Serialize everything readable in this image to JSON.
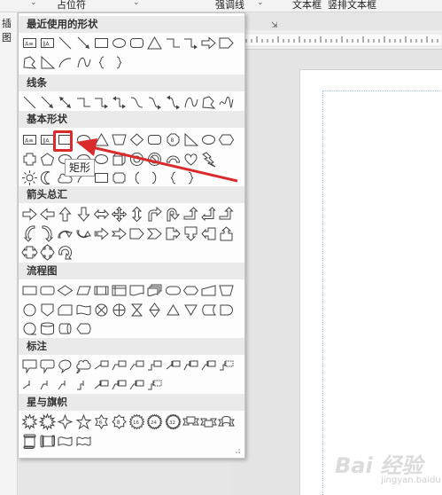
{
  "ribbon": {
    "placeholder_label": "占位符",
    "emphasis_label": "强调线",
    "textbox_label": "文本框",
    "vertical_textbox_label": "竖排文本框",
    "insert_label": "插图"
  },
  "gallery": {
    "sections": [
      {
        "title": "最近使用的形状",
        "rows": [
          [
            "textbox-icon",
            "vertical-textbox-icon",
            "line-icon",
            "arrow-line-icon",
            "rectangle-icon",
            "oval-icon",
            "rounded-rectangle-icon",
            "triangle-icon",
            "elbow-connector-icon",
            "elbow-arrow-connector-icon",
            "right-arrow-icon",
            "pentagon-arrow-icon"
          ],
          [
            "freeform-icon",
            "right-triangle-icon",
            "arc-icon",
            "curve-icon",
            "left-brace-icon",
            "right-brace-icon"
          ]
        ]
      },
      {
        "title": "线条",
        "rows": [
          [
            "line-icon",
            "arrow-line-icon",
            "double-arrow-line-icon",
            "elbow-connector-icon",
            "elbow-arrow-connector-icon",
            "elbow-double-arrow-icon",
            "curved-connector-icon",
            "curved-arrow-connector-icon",
            "curved-double-arrow-icon",
            "curve-icon",
            "freeform-icon",
            "scribble-icon"
          ]
        ]
      },
      {
        "title": "基本形状",
        "rows": [
          [
            "textbox-icon",
            "vertical-textbox-icon",
            "rectangle-icon",
            "oval-icon",
            "triangle-icon",
            "trapezoid-icon",
            "diamond-icon",
            "rounded-rectangle-icon",
            "octagon-icon",
            "right-triangle-icon",
            "oval-icon",
            "hexagon-icon"
          ],
          [
            "cross-icon",
            "pentagon-icon",
            "oval-icon",
            "oval-icon",
            "oval-icon",
            "cube-icon",
            "donut-icon",
            "no-symbol-icon",
            "block-arc-icon",
            "heart-icon",
            "lightning-icon"
          ],
          [
            "sun-icon",
            "moon-icon",
            "cloud-icon",
            "arc-icon",
            "rectangle-icon",
            "plaque-icon",
            "left-bracket-icon",
            "right-bracket-icon",
            "left-brace-icon",
            "right-brace-icon"
          ]
        ]
      },
      {
        "title": "箭头总汇",
        "rows": [
          [
            "right-arrow-icon",
            "left-arrow-icon",
            "up-arrow-icon",
            "down-arrow-icon",
            "left-right-arrow-icon",
            "quad-arrow-icon",
            "up-down-arrow-icon",
            "bent-arrow-icon",
            "u-turn-arrow-icon",
            "bent-up-arrow-icon",
            "left-up-arrow-icon",
            "bent-up-arrow-icon"
          ],
          [
            "curved-left-arrow-icon",
            "curved-right-arrow-icon",
            "curved-down-arrow-icon",
            "curved-up-arrow-icon",
            "striped-right-arrow-icon",
            "notched-right-arrow-icon",
            "pentagon-arrow-icon",
            "chevron-arrow-icon",
            "right-callout-arrow-icon",
            "down-callout-arrow-icon",
            "left-callout-arrow-icon",
            "up-callout-arrow-icon"
          ],
          [
            "left-right-callout-icon",
            "quad-callout-icon",
            "circular-arrow-icon"
          ]
        ]
      },
      {
        "title": "流程图",
        "rows": [
          [
            "process-icon",
            "alternate-process-icon",
            "decision-icon",
            "data-icon",
            "predefined-process-icon",
            "internal-storage-icon",
            "document-icon",
            "multidocument-icon",
            "terminator-icon",
            "preparation-icon",
            "manual-input-icon",
            "manual-operation-icon"
          ],
          [
            "connector-icon",
            "offpage-connector-icon",
            "card-icon",
            "punched-tape-icon",
            "summing-junction-icon",
            "or-icon",
            "collate-icon",
            "sort-icon",
            "extract-icon",
            "merge-icon",
            "stored-data-icon",
            "delay-icon"
          ],
          [
            "sequential-storage-icon",
            "magnetic-disk-icon",
            "direct-access-storage-icon",
            "display-icon"
          ]
        ]
      },
      {
        "title": "标注",
        "rows": [
          [
            "rectangular-callout-icon",
            "rounded-callout-icon",
            "oval-callout-icon",
            "cloud-callout-icon",
            "line-callout-1-icon",
            "line-callout-2-icon",
            "line-callout-3-icon",
            "line-callout-4-icon",
            "line-callout-1-accent-icon",
            "line-callout-2-accent-icon",
            "line-callout-3-accent-icon",
            "line-callout-4-accent-icon"
          ],
          [
            "line-callout-1-noborder-icon",
            "line-callout-2-noborder-icon",
            "line-callout-3-noborder-icon",
            "line-callout-4-noborder-icon",
            "line-callout-1-border-icon",
            "line-callout-2-border-icon",
            "line-callout-3-border-icon",
            "line-callout-4-border-icon"
          ]
        ]
      },
      {
        "title": "星与旗帜",
        "rows": [
          [
            "explosion-1-icon",
            "explosion-2-icon",
            "star-4-icon",
            "star-5-icon",
            "star-6-icon",
            "star-8-icon",
            "star-16-icon",
            "star-24-icon",
            "star-32-icon",
            "up-ribbon-icon",
            "down-ribbon-icon",
            "curved-up-ribbon-icon"
          ],
          [
            "vertical-scroll-icon",
            "horizontal-scroll-icon",
            "wave-icon",
            "double-wave-icon"
          ]
        ]
      }
    ]
  },
  "tooltip": {
    "text": "矩形"
  },
  "selected_shape": "rectangle-icon",
  "colors": {
    "highlight": "#d92b2b",
    "shape_stroke": "#444444"
  },
  "watermark": {
    "text": "Bai 经验",
    "sub": "jingyan.baidu.com"
  }
}
